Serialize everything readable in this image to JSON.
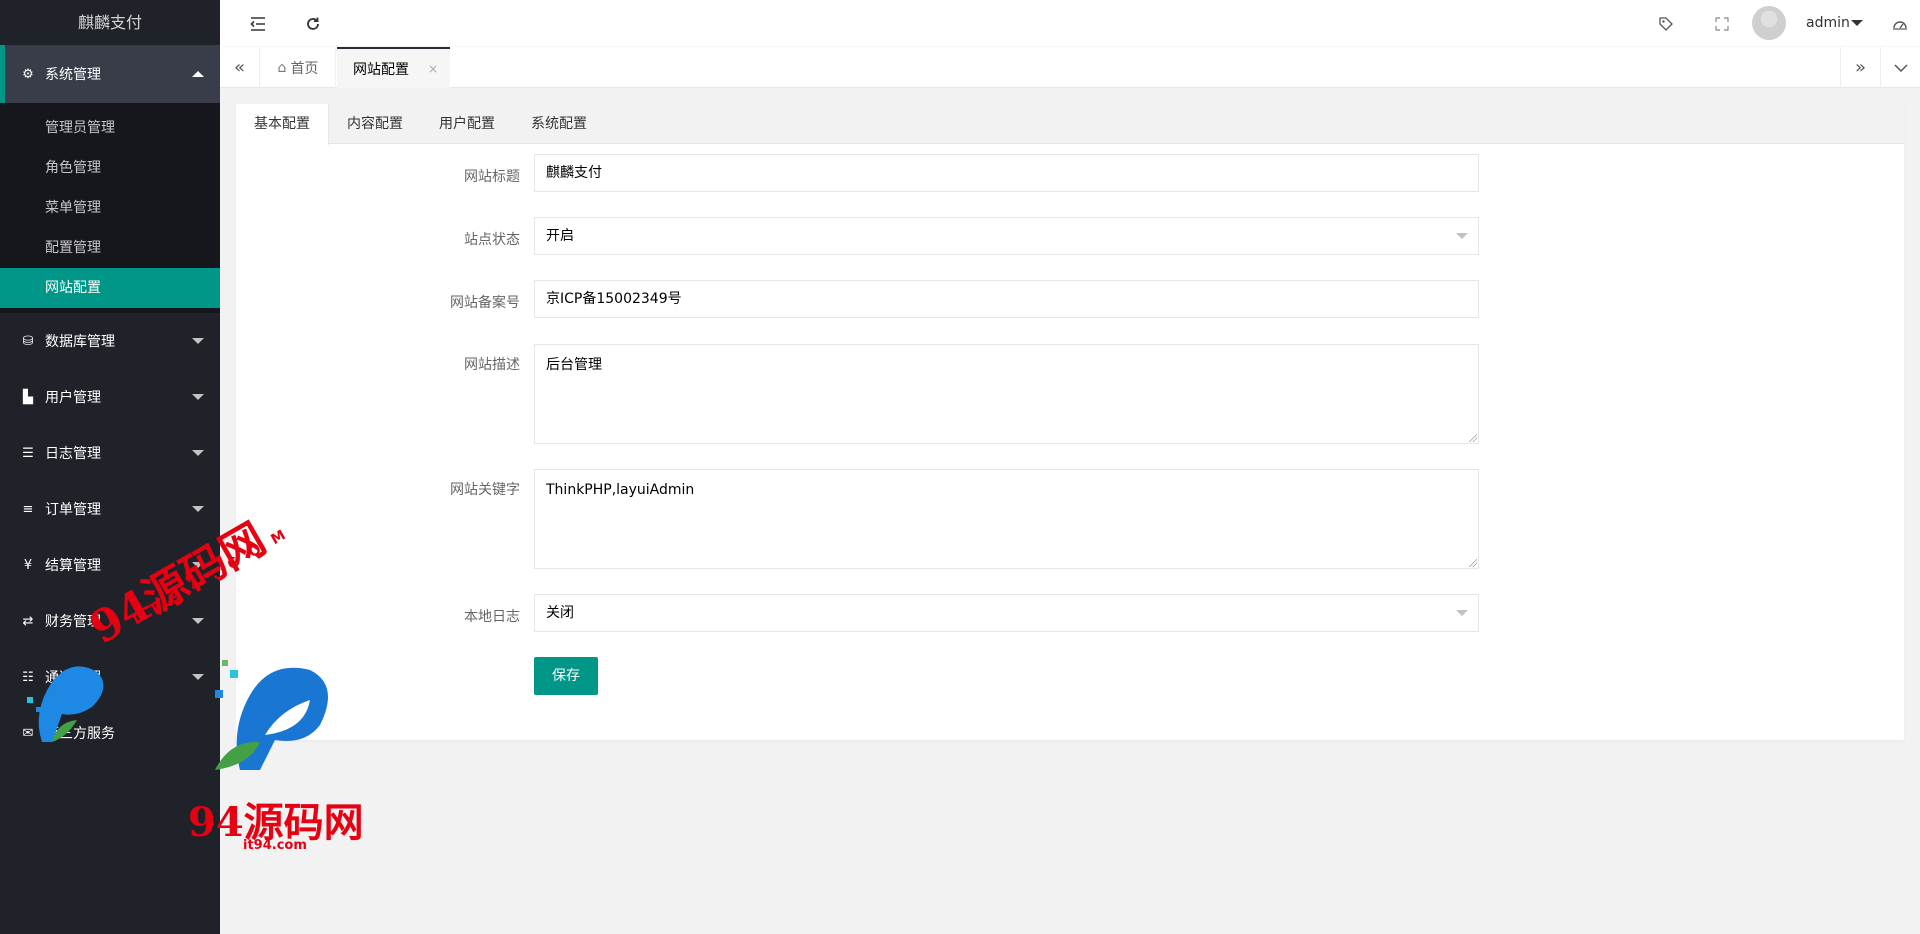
{
  "app": {
    "title": "麒麟支付"
  },
  "sidebar": {
    "groups": [
      {
        "label": "系统管理",
        "icon": "gear-icon",
        "glyph": "⚙",
        "open": true,
        "items": [
          {
            "label": "管理员管理"
          },
          {
            "label": "角色管理"
          },
          {
            "label": "菜单管理"
          },
          {
            "label": "配置管理"
          },
          {
            "label": "网站配置",
            "active": true
          }
        ]
      },
      {
        "label": "数据库管理",
        "icon": "database-icon",
        "glyph": "⛁"
      },
      {
        "label": "用户管理",
        "icon": "user-icon",
        "glyph": "▙"
      },
      {
        "label": "日志管理",
        "icon": "log-icon",
        "glyph": "☰"
      },
      {
        "label": "订单管理",
        "icon": "list-icon",
        "glyph": "≡"
      },
      {
        "label": "结算管理",
        "icon": "yen-icon",
        "glyph": "¥"
      },
      {
        "label": "财务管理",
        "icon": "transfer-icon",
        "glyph": "⇄"
      },
      {
        "label": "通道管理",
        "icon": "channel-icon",
        "glyph": "☷"
      },
      {
        "label": "第三方服务",
        "icon": "mail-icon",
        "glyph": "✉"
      }
    ]
  },
  "header": {
    "user": "admin",
    "icons": [
      "menu-fold-icon",
      "refresh-icon",
      "tag-icon",
      "fullscreen-icon",
      "avatar",
      "theme-icon"
    ]
  },
  "tabsbar": {
    "home": "首页",
    "current": "网站配置",
    "close": "×"
  },
  "form": {
    "tabs": [
      "基本配置",
      "内容配置",
      "用户配置",
      "系统配置"
    ],
    "fields": {
      "title": {
        "label": "网站标题",
        "value": "麒麟支付"
      },
      "status": {
        "label": "站点状态",
        "value": "开启"
      },
      "icp": {
        "label": "网站备案号",
        "value": "京ICP备15002349号"
      },
      "description": {
        "label": "网站描述",
        "value": "后台管理"
      },
      "keywords": {
        "label": "网站关键字",
        "value": "ThinkPHP,layuiAdmin"
      },
      "local_log": {
        "label": "本地日志",
        "value": "关闭"
      }
    },
    "save_label": "保存"
  },
  "watermark": {
    "text1": "94源码网",
    "text2": "IT94.COM",
    "text3": "94源码网",
    "text4": "it94.com"
  }
}
